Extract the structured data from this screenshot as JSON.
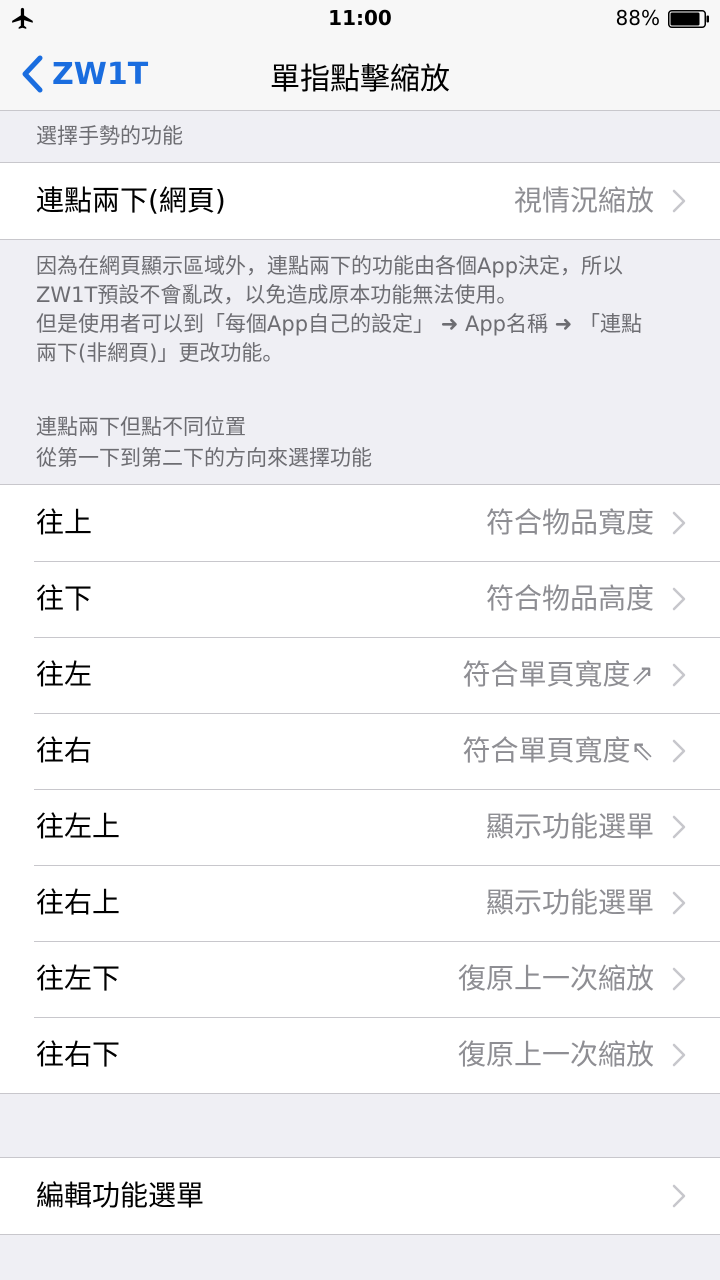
{
  "status_bar": {
    "time": "11:00",
    "battery_percent": "88%",
    "battery_level": 0.88,
    "airplane_mode": "airplane-icon"
  },
  "nav": {
    "back_label": "ZW1T",
    "title": "單指點擊縮放"
  },
  "colors": {
    "accent": "#1a6ddf",
    "background": "#efeff4",
    "secondary_text": "#8e8e93"
  },
  "section1": {
    "header": "選擇手勢的功能",
    "row": {
      "label": "連點兩下(網頁)",
      "value": "視情況縮放"
    },
    "footer_lines": [
      "因為在網頁顯示區域外，連點兩下的功能由各個App決定，所以",
      "ZW1T預設不會亂改，以免造成原本功能無法使用。",
      "但是使用者可以到「每個App自己的設定」 ➜ App名稱 ➜ 「連點",
      "兩下(非網頁)」更改功能。"
    ]
  },
  "section2": {
    "header_lines": [
      "連點兩下但點不同位置",
      "從第一下到第二下的方向來選擇功能"
    ],
    "rows": [
      {
        "label": "往上",
        "value": "符合物品寬度"
      },
      {
        "label": "往下",
        "value": "符合物品高度"
      },
      {
        "label": "往左",
        "value": "符合單頁寬度⇗"
      },
      {
        "label": "往右",
        "value": "符合單頁寬度⇖"
      },
      {
        "label": "往左上",
        "value": "顯示功能選單"
      },
      {
        "label": "往右上",
        "value": "顯示功能選單"
      },
      {
        "label": "往左下",
        "value": "復原上一次縮放"
      },
      {
        "label": "往右下",
        "value": "復原上一次縮放"
      }
    ]
  },
  "section3": {
    "row": {
      "label": "編輯功能選單"
    }
  }
}
